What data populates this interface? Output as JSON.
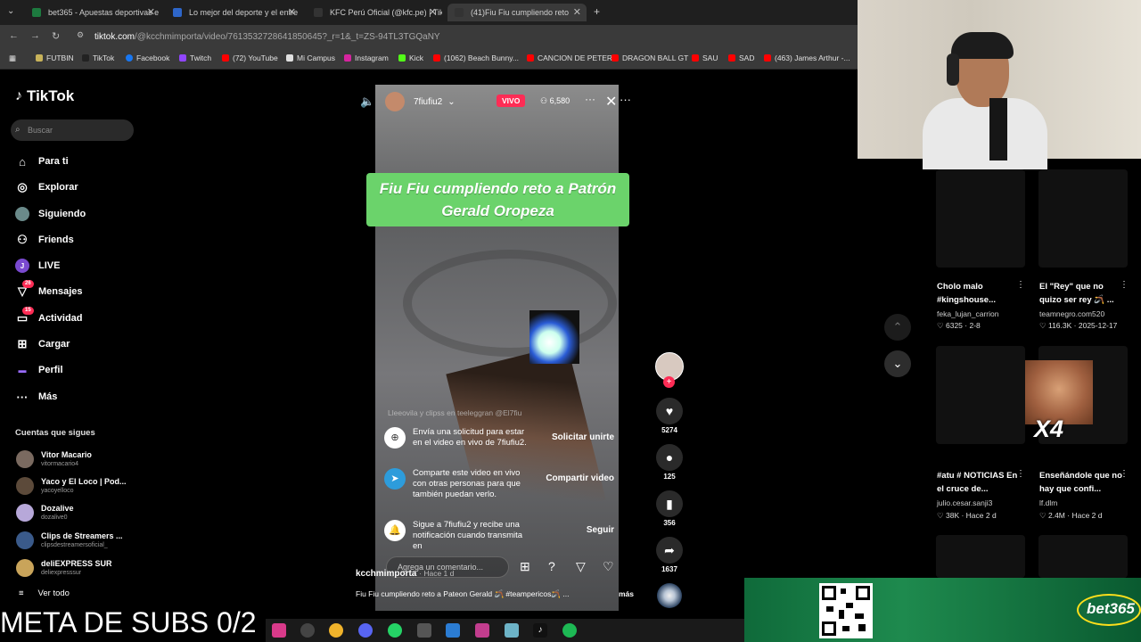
{
  "tabs": [
    {
      "label": "bet365 - Apuestas deportivas e",
      "color": "#1d7a3f"
    },
    {
      "label": "Lo mejor del deporte y el entre",
      "color": "#2e66c9"
    },
    {
      "label": "KFC Perú Oficial (@kfc.pe) | TikT",
      "color": "#111111"
    },
    {
      "label": "(41)Fiu Fiu cumpliendo reto",
      "color": "#111111"
    }
  ],
  "url": {
    "host": "tiktok.com",
    "rest": "/@kcchmimporta/video/7613532728641850645?_r=1&_t=ZS-94TL3TGQaNY"
  },
  "bookmarks": [
    "FUTBIN",
    "TikTok",
    "Facebook",
    "Twitch",
    "(72) YouTube",
    "Mi Campus",
    "Instagram",
    "Kick",
    "(1062) Beach Bunny...",
    "CANCION DE PETER",
    "DRAGON BALL GT",
    "SAU",
    "SAD",
    "(463) James Arthur -..."
  ],
  "sidebar": {
    "logo": "TikTok",
    "search_placeholder": "Buscar",
    "items": [
      {
        "label": "Para ti",
        "icon": "home-icon"
      },
      {
        "label": "Explorar",
        "icon": "compass-icon"
      },
      {
        "label": "Siguiendo",
        "icon": "following-icon"
      },
      {
        "label": "Friends",
        "icon": "friends-icon"
      },
      {
        "label": "LIVE",
        "icon": "live-icon"
      },
      {
        "label": "Mensajes",
        "icon": "message-icon",
        "badge": "26"
      },
      {
        "label": "Actividad",
        "icon": "activity-icon",
        "badge": "15"
      },
      {
        "label": "Cargar",
        "icon": "upload-icon"
      },
      {
        "label": "Perfil",
        "icon": "profile-icon"
      },
      {
        "label": "Más",
        "icon": "more-icon"
      }
    ],
    "following_title": "Cuentas que sigues",
    "accounts": [
      {
        "name": "Vitor Macario",
        "handle": "vitormacario4"
      },
      {
        "name": "Yaco y El Loco | Pod...",
        "handle": "yacoyelloco"
      },
      {
        "name": "Dozalive",
        "handle": "dozalive0"
      },
      {
        "name": "Clips de Streamers ...",
        "handle": "clipsdestreamersoficial_"
      },
      {
        "name": "deliEXPRESS SUR",
        "handle": "deliexpresssur"
      }
    ],
    "see_all": "Ver todo"
  },
  "video": {
    "live_user": "7fiufiu2",
    "live_badge": "VIVO",
    "viewers": "6,580",
    "overlay_caption": "Fiu Fiu cumpliendo reto a Patrón Gerald Oropeza",
    "live_comment": "Lleeovila y clipss en teeleggran @El7fiu",
    "prompts": [
      {
        "text": "Envía una solicitud para estar en el video en vivo de 7fiufiu2.",
        "button": "Solicitar unirte"
      },
      {
        "text": "Comparte este video en vivo con otras personas para que también puedan verlo.",
        "button": "Compartir video"
      },
      {
        "text": "Sigue a 7fiufiu2 y recibe una notificación cuando transmita en",
        "button": "Seguir"
      }
    ],
    "comment_placeholder": "Agrega un comentario...",
    "author": "kcchmimporta",
    "date": "· Hace 1 d",
    "description": "Fiu Fiu cumpliendo reto a Pateon Gerald 🪃 #teampericos🪃 ...",
    "more": "más"
  },
  "actions": {
    "likes": "5274",
    "comments": "125",
    "saves": "356",
    "shares": "1637"
  },
  "recommendations": [
    {
      "title": "Cholo malo #kingshouse...",
      "author": "feka_lujan_carrion",
      "likes": "6325",
      "date": "2-8"
    },
    {
      "title": "El \"Rey\" que no quizo ser rey 🪃 ...",
      "author": "teamnegro.com520",
      "likes": "116.3K",
      "date": "2025-12-17"
    },
    {
      "title": "#atu # NOTICIAS En el cruce de...",
      "author": "julio.cesar.sanji3",
      "likes": "38K",
      "date": "Hace 2 d"
    },
    {
      "title": "Enseñándole que no hay que confi...",
      "author": "lf.dlm",
      "likes": "2.4M",
      "date": "Hace 2 d"
    }
  ],
  "meme_text": "X4",
  "ad": {
    "brand": "bet365"
  },
  "stream_overlay": "META DE SUBS 0/2"
}
